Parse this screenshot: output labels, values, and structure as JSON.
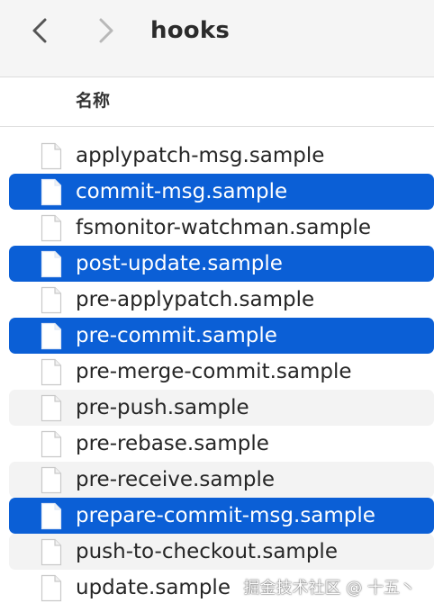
{
  "toolbar": {
    "title": "hooks",
    "back_icon": "chevron-left-icon",
    "forward_icon": "chevron-right-icon"
  },
  "header": {
    "column_name": "名称"
  },
  "files": [
    {
      "name": "applypatch-msg.sample",
      "selected": false
    },
    {
      "name": "commit-msg.sample",
      "selected": true
    },
    {
      "name": "fsmonitor-watchman.sample",
      "selected": false
    },
    {
      "name": "post-update.sample",
      "selected": true
    },
    {
      "name": "pre-applypatch.sample",
      "selected": false
    },
    {
      "name": "pre-commit.sample",
      "selected": true
    },
    {
      "name": "pre-merge-commit.sample",
      "selected": false
    },
    {
      "name": "pre-push.sample",
      "selected": false
    },
    {
      "name": "pre-rebase.sample",
      "selected": false
    },
    {
      "name": "pre-receive.sample",
      "selected": false
    },
    {
      "name": "prepare-commit-msg.sample",
      "selected": true
    },
    {
      "name": "push-to-checkout.sample",
      "selected": false
    },
    {
      "name": "update.sample",
      "selected": false
    }
  ],
  "watermark": "掘金技术社区 @ 十五丶",
  "colors": {
    "selection": "#0b5fd6",
    "alt_row": "#f3f3f3",
    "toolbar_bg": "#f5f5f5"
  }
}
